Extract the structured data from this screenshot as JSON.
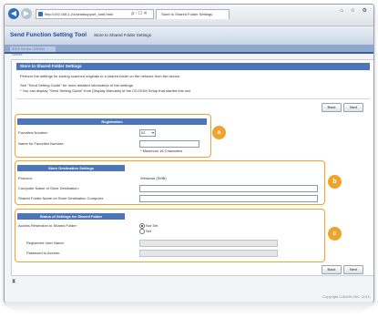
{
  "browser": {
    "url": "http://192.168.1.24/sendsupport_smb.html",
    "tab_title": "Store to Shared Folder Settings",
    "back_glyph": "◀",
    "forward_glyph": "▶",
    "address_tools": "ρ - ☐ ✕",
    "window_icons": "⌂ ☆ ⚙"
  },
  "app": {
    "title": "Send Function Setting Tool",
    "subtitle": "Store to Shared Folder Settings",
    "device": "iRFA Series / MF6xx Series"
  },
  "page": {
    "section_title": "Store to Shared Folder Settings",
    "desc1": "Perform the settings for storing scanned originals to a shared folder on the network from the device.",
    "desc2": "See \"Send Setting Guide\" for more detailed information of the settings.",
    "desc3": "* You can display \"Send Setting Guide\" from [Display Manuals] of the CD-ROM Setup that started this tool.",
    "back": "Back",
    "next": "Next",
    "scroll_top_icon": "⧗",
    "copyright": "Copyright CANON INC. 2015"
  },
  "registration": {
    "title": "Registration",
    "favorites_label": "Favorites Number:",
    "favorites_value": "02",
    "name_label": "Name for Favorites Number:",
    "name_value": "",
    "max_note": "* Maximum 16 Characters",
    "badge": "a"
  },
  "destination": {
    "title": "Store Destination Settings",
    "protocol_label": "Protocol:",
    "protocol_value": "Windows (SMB)",
    "computer_label": "Computer Name of Store Destination:",
    "computer_value": "",
    "folder_label": "Shared Folder Name on Store Destination Computer:",
    "folder_value": "",
    "badge": "b"
  },
  "status": {
    "title": "Status of Settings for Shared Folder",
    "restriction_label": "Access Restriction to Shared Folder:",
    "option_not_set": "Not Set",
    "option_set": "Set",
    "user_label": "Registered User Name:",
    "password_label": "Password to Access:",
    "badge": "c"
  },
  "colors": {
    "accent": "#4d76b8",
    "highlight": "#f0a32b"
  }
}
